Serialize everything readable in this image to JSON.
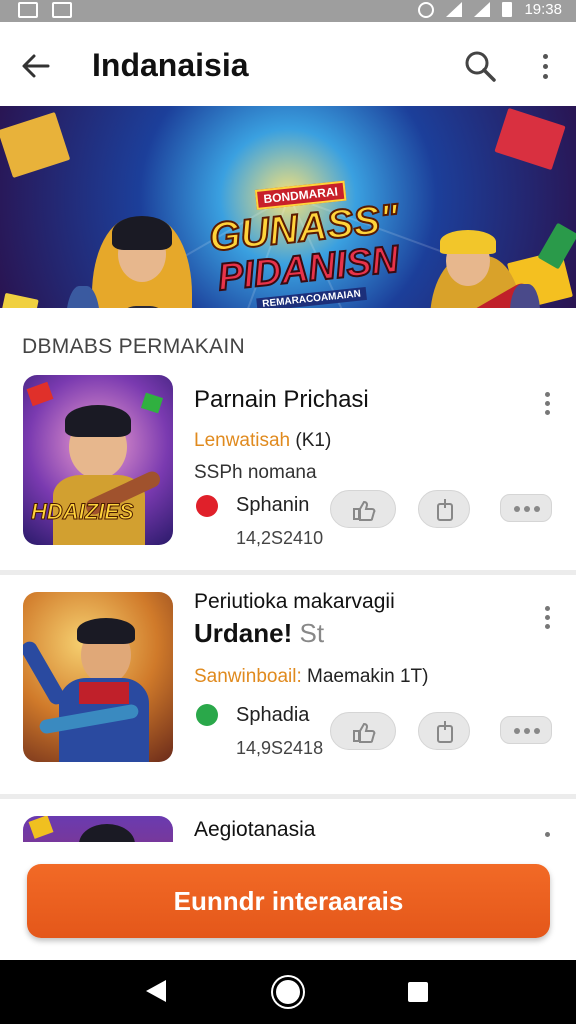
{
  "status_bar": {
    "time": "19:38",
    "icons": [
      "image-icon",
      "photo-icon",
      "alarm-icon",
      "wifi-icon",
      "signal-icon",
      "battery-icon"
    ]
  },
  "app_bar": {
    "title": "Indanaisia",
    "icons": [
      "back-arrow-icon",
      "search-icon",
      "more-vertical-icon"
    ]
  },
  "banner": {
    "top_tag": "BONDMARAI",
    "line1": "GUNASS\"",
    "line2": "PIDANISN",
    "subtitle": "REMARACOAMAIAN"
  },
  "section_label": "DBMABS PERMAKAIN",
  "games": [
    {
      "thumb_label": "HDAIZIES",
      "title": "Parnain Prichasi",
      "accent": "Lenwatisah",
      "accent_suffix": "(K1)",
      "meta": "SSPh nomana",
      "source_name": "Sphanin",
      "source_count": "14,2S2410",
      "source_color": "#e0202a"
    },
    {
      "title": "Periutioka makarvagii",
      "bold_title": "Urdane!",
      "bold_suffix": "St",
      "accent": "Sanwinboail:",
      "accent_suffix": "Maemakin 1T)",
      "source_name": "Sphadia",
      "source_count": "14,9S2418",
      "source_color": "#2aa84a"
    },
    {
      "title": "Aegiotanasia"
    }
  ],
  "cta_label": "Eunndr interaarais",
  "colors": {
    "accent_orange": "#e4571a",
    "accent_text": "#e08a1e"
  }
}
